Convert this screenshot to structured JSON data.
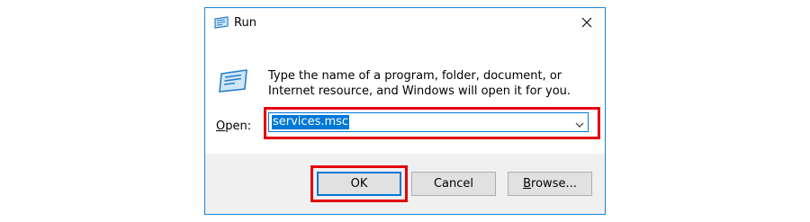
{
  "window": {
    "title": "Run",
    "title_icon": "run-icon",
    "close_icon": "close-icon"
  },
  "content": {
    "icon": "run-icon",
    "description": "Type the name of a program, folder, document, or Internet resource, and Windows will open it for you.",
    "open_label_prefix": "O",
    "open_label_rest": "pen:",
    "open_value": "services.msc",
    "dropdown_icon": "chevron-down-icon"
  },
  "buttons": {
    "ok": "OK",
    "cancel": "Cancel",
    "browse_prefix": "B",
    "browse_rest": "rowse..."
  },
  "colors": {
    "accent": "#0078d7",
    "highlight": "#e3000f",
    "footer_bg": "#f0f0f0"
  }
}
